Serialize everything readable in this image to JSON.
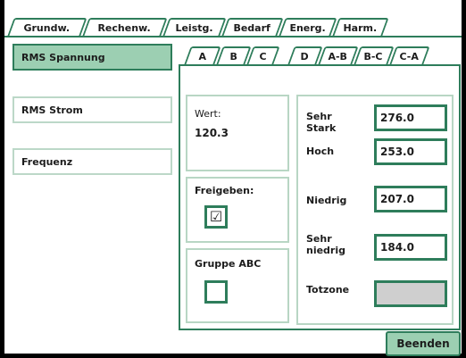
{
  "top_tabs": [
    {
      "label": "Grundw."
    },
    {
      "label": "Rechenw."
    },
    {
      "label": "Leistg."
    },
    {
      "label": "Bedarf"
    },
    {
      "label": "Energ."
    },
    {
      "label": "Harm."
    }
  ],
  "sidebar": {
    "items": [
      {
        "label": "RMS Spannung",
        "active": true
      },
      {
        "label": "RMS Strom",
        "active": false
      },
      {
        "label": "Frequenz",
        "active": false
      }
    ]
  },
  "phase_tabs": [
    {
      "label": "A"
    },
    {
      "label": "B"
    },
    {
      "label": "C"
    },
    {
      "label": "D"
    },
    {
      "label": "A-B"
    },
    {
      "label": "B-C"
    },
    {
      "label": "C-A"
    }
  ],
  "value_panel": {
    "label": "Wert:",
    "value": "120.3"
  },
  "enable_panel": {
    "label": "Freigeben:",
    "checked": true,
    "mark": "☑"
  },
  "group_panel": {
    "label": "Gruppe ABC",
    "checked": false
  },
  "thresholds": {
    "very_high": {
      "label_line1": "Sehr",
      "label_line2": "Stark",
      "value": "276.0"
    },
    "high": {
      "label": "Hoch",
      "value": "253.0"
    },
    "low": {
      "label": "Niedrig",
      "value": "207.0"
    },
    "very_low": {
      "label_line1": "Sehr",
      "label_line2": "niedrig",
      "value": "184.0"
    },
    "deadband": {
      "label": "Totzone",
      "value": ""
    }
  },
  "exit_button": {
    "label": "Beenden"
  },
  "colors": {
    "accent": "#2e7d5b",
    "active_fill": "#9ccfb2",
    "panel_border": "#b8d6c4"
  }
}
